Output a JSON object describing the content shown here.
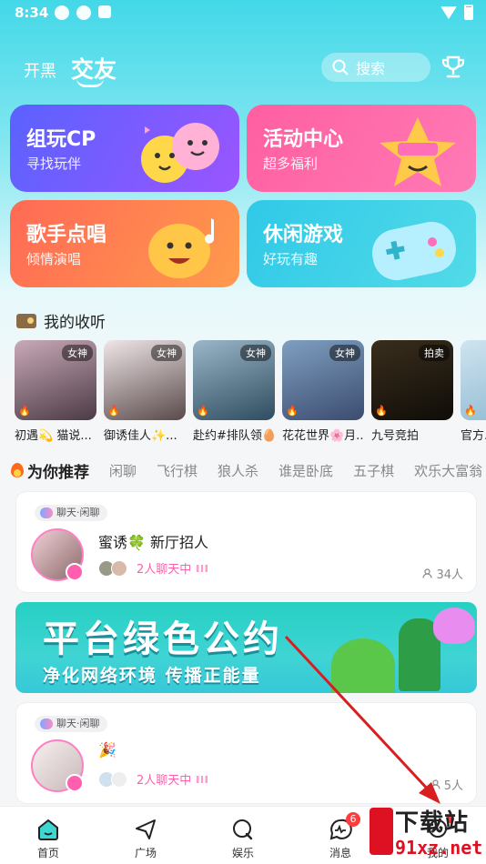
{
  "status": {
    "time": "8:34"
  },
  "header": {
    "tab_kaihei": "开黑",
    "tab_jiaoyou": "交友",
    "search_placeholder": "搜索"
  },
  "cards": [
    {
      "title": "组玩CP",
      "sub": "寻找玩伴"
    },
    {
      "title": "活动中心",
      "sub": "超多福利"
    },
    {
      "title": "歌手点唱",
      "sub": "倾情演唱"
    },
    {
      "title": "休闲游戏",
      "sub": "好玩有趣"
    }
  ],
  "listening": {
    "title": "我的收听",
    "rooms": [
      {
        "name": "初遇💫 猫说...",
        "tag": "女神",
        "color_a": "#c9a9b8",
        "color_b": "#4b3a45"
      },
      {
        "name": "御诱佳人✨...",
        "tag": "女神",
        "color_a": "#efe6e8",
        "color_b": "#5a4a4a"
      },
      {
        "name": "赴约#排队领🥚",
        "tag": "女神",
        "color_a": "#9ab6c8",
        "color_b": "#2f4d60"
      },
      {
        "name": "花花世界🌸月...",
        "tag": "女神",
        "color_a": "#7f9fc0",
        "color_b": "#3b4c70"
      },
      {
        "name": "九号竞拍",
        "tag": "拍卖",
        "color_a": "#3a2e1c",
        "color_b": "#0f0c08"
      },
      {
        "name": "官方...",
        "tag": "",
        "color_a": "#cfe4f0",
        "color_b": "#8cb8d0"
      }
    ]
  },
  "categories": {
    "active": "为你推荐",
    "items": [
      "闲聊",
      "飞行棋",
      "狼人杀",
      "谁是卧底",
      "五子棋",
      "欢乐大富翁"
    ]
  },
  "feed": [
    {
      "chip": "聊天·闲聊",
      "title": "蜜诱🍀 新厅招人",
      "chatting": "2人聊天中",
      "count": "34人"
    },
    {
      "chip": "聊天·闲聊",
      "title": "🎉",
      "chatting": "2人聊天中",
      "count": "5人"
    }
  ],
  "banner": {
    "line1": "平台绿色公约",
    "line2": "净化网络环境 传播正能量"
  },
  "tabbar": {
    "home": "首页",
    "plaza": "广场",
    "entertainment": "娱乐",
    "messages": "消息",
    "messages_badge": "6",
    "mine": "我的"
  },
  "watermark": {
    "line1": "下载站",
    "line2": "91xz.net"
  },
  "colors": {
    "accent_cyan": "#43d8e8",
    "pink": "#ff5fae",
    "badge_red": "#ff3b3b",
    "arrow_red": "#d81e1e"
  }
}
